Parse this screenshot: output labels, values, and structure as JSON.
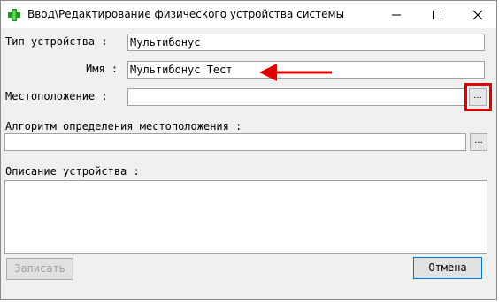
{
  "window": {
    "title": "Ввод\\Редактирование физического устройства системы",
    "icons": {
      "app": "plus-app-icon",
      "minimize": "minimize-icon",
      "maximize": "maximize-icon",
      "close": "close-icon"
    }
  },
  "form": {
    "device_type": {
      "label": "Тип устройства :",
      "value": "Мультибонус"
    },
    "name": {
      "label": "Имя :",
      "value": "Мультибонус Тест"
    },
    "location": {
      "label": "Местоположение :",
      "value": "",
      "browse_label": "..."
    },
    "location_algorithm": {
      "label": "Алгоритм определения местоположения :",
      "value": "",
      "browse_label": "..."
    },
    "description": {
      "label": "Описание устройства :",
      "value": ""
    }
  },
  "buttons": {
    "save": "Записать",
    "cancel": "Отмена"
  },
  "colors": {
    "annotation": "#e00000",
    "accent": "#0078d7",
    "icon_green": "#1aa01a"
  }
}
